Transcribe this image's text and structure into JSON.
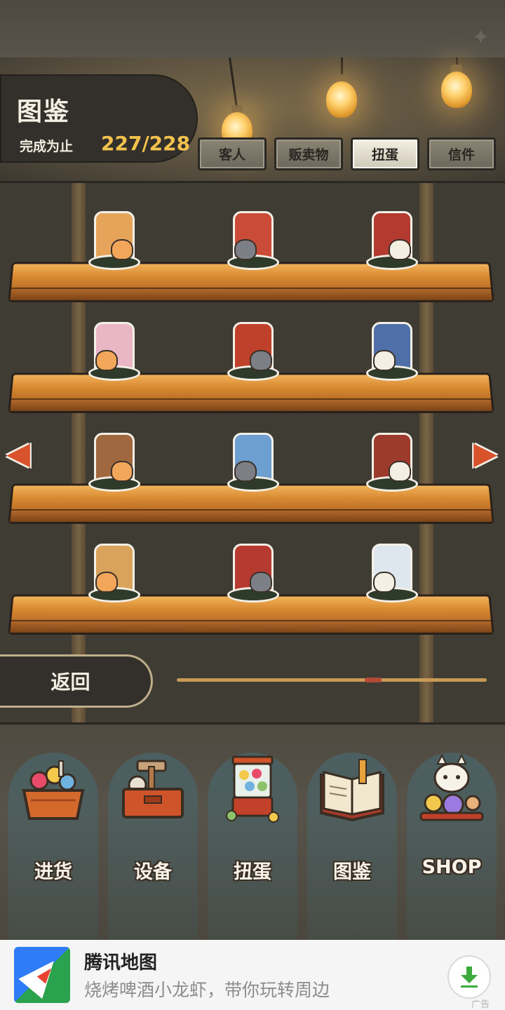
{
  "header": {
    "title": "图鉴",
    "progress_label": "完成为止",
    "progress_value": "227/228",
    "tabs": [
      {
        "label": "客人",
        "active": false
      },
      {
        "label": "贩卖物",
        "active": false
      },
      {
        "label": "扭蛋",
        "active": true
      },
      {
        "label": "信件",
        "active": false
      }
    ]
  },
  "collection": {
    "items": [
      {
        "icon": "cat-with-pot-figurine",
        "color": "#e6a45a"
      },
      {
        "icon": "cat-with-banner-figurine",
        "color": "#c94b38"
      },
      {
        "icon": "cat-on-tv-figurine",
        "color": "#b23a2e"
      },
      {
        "icon": "cat-with-bonsai-figurine",
        "color": "#e9b6c6"
      },
      {
        "icon": "cat-on-mailbox-figurine",
        "color": "#c0412b"
      },
      {
        "icon": "cat-at-window-figurine",
        "color": "#4f6fa8"
      },
      {
        "icon": "cat-on-bench-figurine",
        "color": "#a0683e"
      },
      {
        "icon": "cat-with-lantern-figurine",
        "color": "#6d9fd0"
      },
      {
        "icon": "cat-at-phone-booth-figurine",
        "color": "#9c3a2c"
      },
      {
        "icon": "cat-with-bucket-figurine",
        "color": "#d9a35c"
      },
      {
        "icon": "cat-under-kotatsu-figurine",
        "color": "#b63a30"
      },
      {
        "icon": "cat-in-snow-figurine",
        "color": "#dfe7ee"
      }
    ],
    "prev_icon": "chevron-left-icon",
    "next_icon": "chevron-right-icon"
  },
  "footer": {
    "back_label": "返回",
    "scroll_position": 0.64
  },
  "bottom_nav": {
    "items": [
      {
        "label": "进货",
        "icon": "supply-basket-icon"
      },
      {
        "label": "设备",
        "icon": "toolbox-icon"
      },
      {
        "label": "扭蛋",
        "icon": "gacha-machine-icon"
      },
      {
        "label": "图鉴",
        "icon": "open-book-icon"
      },
      {
        "label": "SHOP",
        "icon": "lucky-cat-icon"
      }
    ]
  },
  "ad": {
    "app_name": "腾讯地图",
    "tagline": "烧烤啤酒小龙虾，带你玩转周边",
    "tag": "广告",
    "logo_icon": "tencent-map-logo-icon",
    "download_icon": "download-icon"
  },
  "colors": {
    "accent_gold": "#f3c24e",
    "shelf_wood": "#d98a32",
    "arrow_red": "#d8522c",
    "panel_dark": "#33302b"
  }
}
